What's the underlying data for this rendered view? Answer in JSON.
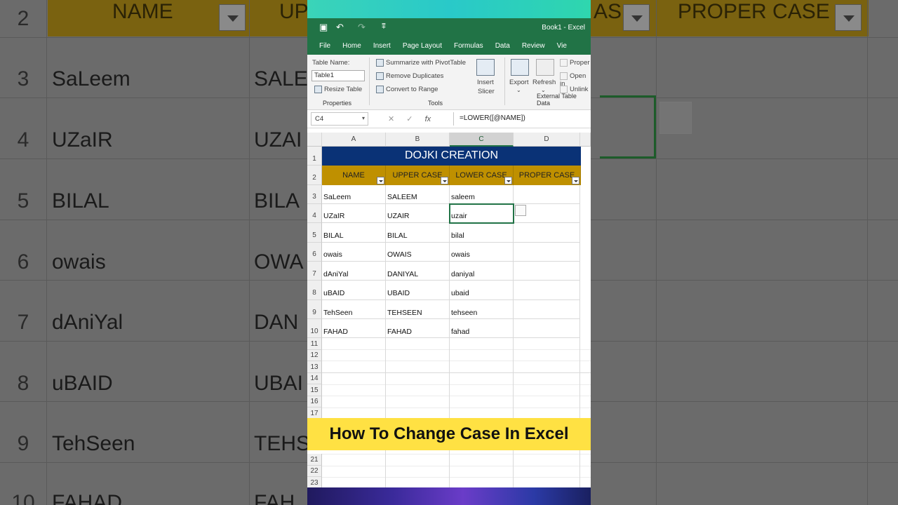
{
  "app": {
    "doc_title": "Book1 - Excel"
  },
  "menu": [
    "File",
    "Home",
    "Insert",
    "Page Layout",
    "Formulas",
    "Data",
    "Review",
    "Vie"
  ],
  "ribbon": {
    "table_name_label": "Table Name:",
    "table_name_value": "Table1",
    "resize_table": "Resize Table",
    "properties_group": "Properties",
    "summarize_pivot": "Summarize with PivotTable",
    "remove_duplicates": "Remove Duplicates",
    "convert_to_range": "Convert to Range",
    "insert_slicer_1": "Insert",
    "insert_slicer_2": "Slicer",
    "tools_group": "Tools",
    "export": "Export",
    "refresh": "Refresh",
    "properties_btn": "Proper",
    "open_in": "Open in",
    "unlink": "Unlink",
    "external_group": "External Table Data"
  },
  "formula_bar": {
    "name_box": "C4",
    "formula": "=LOWER([@NAME])",
    "fx": "fx"
  },
  "columns": [
    "A",
    "B",
    "C",
    "D"
  ],
  "sheet": {
    "title": "DOJKI CREATION",
    "headers": [
      "NAME",
      "UPPER CASE",
      "LOWER CASE",
      "PROPER CASE"
    ],
    "rows": [
      [
        "SaLeem",
        "SALEEM",
        "saleem"
      ],
      [
        "UZaIR",
        "UZAIR",
        "uzair"
      ],
      [
        "BILAL",
        "BILAL",
        "bilal"
      ],
      [
        "owais",
        "OWAIS",
        "owais"
      ],
      [
        "dAniYal",
        "DANIYAL",
        "daniyal"
      ],
      [
        "uBAID",
        "UBAID",
        "ubaid"
      ],
      [
        "TehSeen",
        "TEHSEEN",
        "tehseen"
      ],
      [
        "FAHAD",
        "FAHAD",
        "fahad"
      ]
    ],
    "row_numbers": [
      "1",
      "2",
      "3",
      "4",
      "5",
      "6",
      "7",
      "8",
      "9",
      "10",
      "11",
      "12",
      "13",
      "14",
      "15",
      "16",
      "17",
      "21",
      "22",
      "23"
    ]
  },
  "banner": "How To Change Case In Excel",
  "background": {
    "row_numbers": [
      "2",
      "3",
      "4",
      "5",
      "6",
      "7",
      "8",
      "9",
      "10"
    ],
    "names": [
      "SaLeem",
      "UZaIR",
      "BILAL",
      "owais",
      "dAniYal",
      "uBAID",
      "TehSeen",
      "FAHAD"
    ],
    "upper_partial": [
      "SALE",
      "UZAI",
      "BILA",
      "OWA",
      "DAN",
      "UBAI",
      "TEHS",
      "FAH"
    ],
    "headers": [
      "NAME",
      "UP",
      "AS",
      "PROPER CASE"
    ]
  },
  "colors": {
    "excel_green": "#217346",
    "title_blue": "#0a3276",
    "header_gold": "#bf9000",
    "banner_yellow": "#ffe143"
  }
}
